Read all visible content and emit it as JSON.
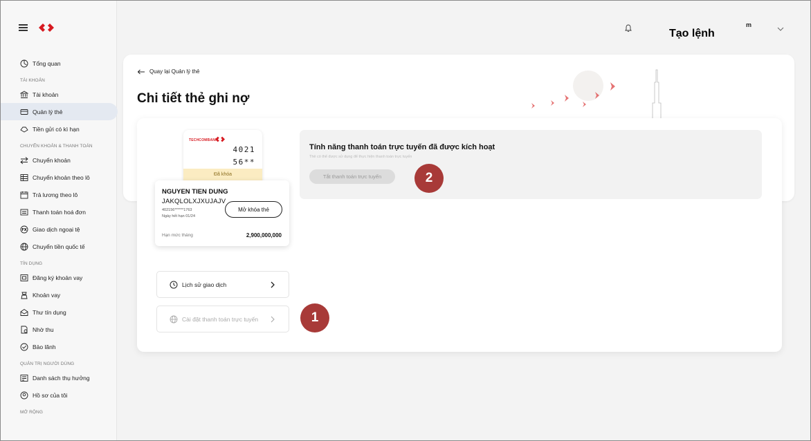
{
  "topbar": {
    "create_order": "Tạo lệnh",
    "user_initial": "m"
  },
  "sidebar": {
    "items": [
      {
        "type": "item",
        "label": "Tổng quan",
        "icon": "dashboard-icon"
      },
      {
        "type": "section",
        "label": "TÀI KHOẢN"
      },
      {
        "type": "item",
        "label": "Tài khoản",
        "icon": "bank-icon"
      },
      {
        "type": "item",
        "label": "Quản lý thẻ",
        "icon": "card-icon",
        "active": true
      },
      {
        "type": "item",
        "label": "Tiền gửi có kì hạn",
        "icon": "deposit-icon"
      },
      {
        "type": "section",
        "label": "CHUYỂN KHOẢN & THANH TOÁN"
      },
      {
        "type": "item",
        "label": "Chuyển khoản",
        "icon": "transfer-icon"
      },
      {
        "type": "item",
        "label": "Chuyển khoản theo lô",
        "icon": "batch-transfer-icon"
      },
      {
        "type": "item",
        "label": "Trả lương theo lô",
        "icon": "payroll-icon"
      },
      {
        "type": "item",
        "label": "Thanh toán hoá đơn",
        "icon": "bill-icon"
      },
      {
        "type": "item",
        "label": "Giao dịch ngoại tệ",
        "icon": "fx-icon"
      },
      {
        "type": "item",
        "label": "Chuyển tiền quốc tế",
        "icon": "globe-icon"
      },
      {
        "type": "section",
        "label": "TÍN DỤNG"
      },
      {
        "type": "item",
        "label": "Đăng ký khoản vay",
        "icon": "loan-register-icon"
      },
      {
        "type": "item",
        "label": "Khoản vay",
        "icon": "loan-icon"
      },
      {
        "type": "item",
        "label": "Thư tín dụng",
        "icon": "letter-credit-icon"
      },
      {
        "type": "item",
        "label": "Nhờ thu",
        "icon": "collection-icon"
      },
      {
        "type": "item",
        "label": "Bảo lãnh",
        "icon": "guarantee-icon"
      },
      {
        "type": "section",
        "label": "QUẢN TRỊ NGƯỜI DÙNG"
      },
      {
        "type": "item",
        "label": "Danh sách thụ hưởng",
        "icon": "beneficiary-icon"
      },
      {
        "type": "item",
        "label": "Hồ sơ của tôi",
        "icon": "profile-icon"
      },
      {
        "type": "section",
        "label": "MỞ RỘNG"
      }
    ]
  },
  "header": {
    "back_label": "Quay lại Quản lý thẻ",
    "title": "Chi tiết thẻ ghi nợ"
  },
  "card": {
    "brand": "TECHCOMBANK",
    "number_line1": "4021",
    "number_line2": "56**",
    "locked_label": "Đã khóa",
    "holder": "NGUYEN TIEN DUNG",
    "code": "JAKQLOLXJXUJAJV",
    "masked_number": "402156******1763",
    "expiry": "Ngày hết hạn 01/24",
    "unlock_label": "Mở khóa thẻ",
    "limit_label": "Hạn mức tháng",
    "limit_value": "2,900,000,000"
  },
  "menu": {
    "history_label": "Lịch sử giao dịch",
    "online_settings_label": "Cài đặt thanh toán trực tuyến"
  },
  "status": {
    "title": "Tính năng thanh toán trực tuyến đã được kích hoạt",
    "subtitle": "Thẻ có thể được sử dụng để thực hiện thanh toán trực tuyến",
    "button_label": "Tắt thanh toán trực tuyến"
  },
  "badges": {
    "one": "1",
    "two": "2"
  },
  "colors": {
    "brand_red": "#d71920",
    "badge": "#a83a38",
    "active_bg": "#e4e9f1"
  }
}
